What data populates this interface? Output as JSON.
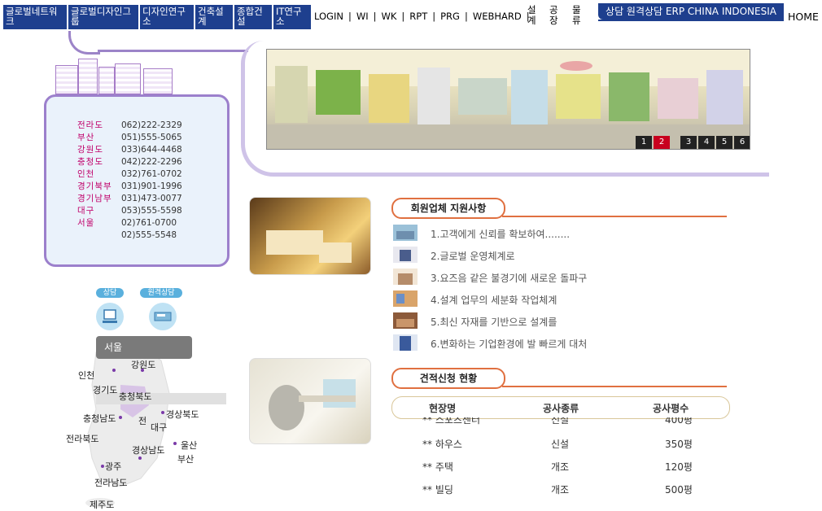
{
  "nav": {
    "buttons": [
      "글로벌네트워크",
      "글로벌디자인그룹",
      "디자인연구소",
      "건축설계",
      "종합건설",
      "IT연구소"
    ],
    "links": [
      "LOGIN",
      "WI",
      "WK",
      "RPT",
      "PRG",
      "WEBHARD"
    ],
    "separator": "|",
    "vertical": [
      "설계",
      "공장",
      "물류"
    ],
    "erp": "상담 원격상담 ERP CHINA INDONESIA",
    "home": "HOME"
  },
  "phones": [
    {
      "region": "전라도",
      "number": "062)222-2329"
    },
    {
      "region": "부산",
      "number": "051)555-5065"
    },
    {
      "region": "강원도",
      "number": "033)644-4468"
    },
    {
      "region": "충청도",
      "number": "042)222-2296"
    },
    {
      "region": "인천",
      "number": "032)761-0702"
    },
    {
      "region": "경기북부",
      "number": "031)901-1996"
    },
    {
      "region": "경기남부",
      "number": "031)473-0077"
    },
    {
      "region": "대구",
      "number": "053)555-5598"
    },
    {
      "region": "서울",
      "number": "02)761-0700"
    },
    {
      "region": "",
      "number": "02)555-5548"
    }
  ],
  "banner_pages": [
    "1",
    "2",
    "3",
    "4",
    "5",
    "6"
  ],
  "banner_active": 2,
  "support": {
    "title": "회원업체 지원사항",
    "items": [
      "1.고객에게 신뢰를 확보하여........",
      "2.글로벌 운영체계로",
      "3.요즈음 같은 불경기에 새로운 돌파구",
      "4.설계 업무의 세분화 작업체계",
      "5.최신 자재를 기반으로 설계를",
      "6.변화하는 기업환경에 발 빠르게 대처"
    ]
  },
  "estimate": {
    "title": "견적신청 현황",
    "columns": [
      "현장명",
      "공사종류",
      "공사평수"
    ],
    "rows": [
      [
        "** 스포츠센터",
        "신설",
        "400평"
      ],
      [
        "** 하우스",
        "신설",
        "350평"
      ],
      [
        "** 주택",
        "개조",
        "120평"
      ],
      [
        "** 빌딩",
        "개조",
        "500평"
      ]
    ]
  },
  "consult": {
    "label1": "상담",
    "label2": "원격상담"
  },
  "map": {
    "tooltip": "서울",
    "labels": [
      "강원도",
      "인천",
      "경기도",
      "충청북도",
      "경상북도",
      "충청남도",
      "전",
      "대구",
      "전라북도",
      "경상남도",
      "울산",
      "부산",
      "광주",
      "전라남도",
      "제주도"
    ]
  }
}
